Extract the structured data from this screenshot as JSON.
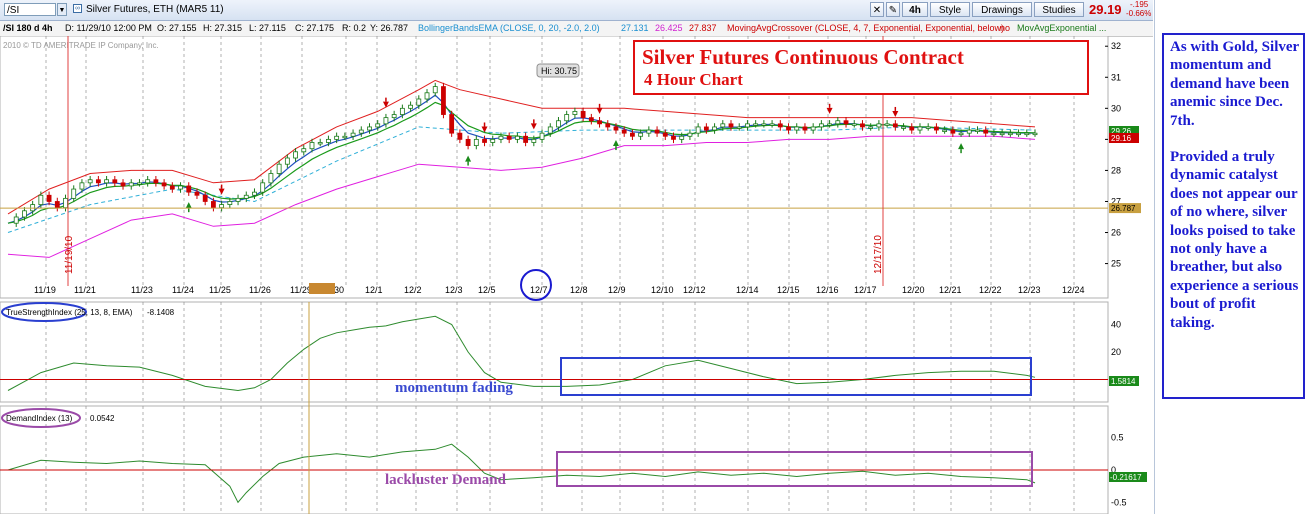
{
  "toolbar": {
    "symbol": "/SI",
    "instrument": "Silver Futures, ETH (MAR5 11)",
    "timeframe": "4h",
    "style_label": "Style",
    "drawings_label": "Drawings",
    "studies_label": "Studies",
    "last_price": "29.19",
    "change_abs": "-.195",
    "change_pct": "-0.66%"
  },
  "infobar": {
    "chart_id": "/SI 180 d 4h",
    "date": "D: 11/29/10 12:00 PM",
    "open": "O: 27.155",
    "high": "H: 27.315",
    "low": "L: 27.115",
    "close": "C: 27.175",
    "range": "R: 0.2",
    "y": "Y: 26.787",
    "bb_study": "BollingerBandsEMA (CLOSE, 0, 20, -2.0, 2.0)",
    "bb_v1": "27.131",
    "bb_v2": "26.425",
    "bb_v3": "27.837",
    "ma_study": "MovingAvgCrossover (CLOSE, 4, 7, Exponential, Exponential, below)",
    "ma_flag": "no",
    "ma_study2": "MovAvgExponential ..."
  },
  "annotations": {
    "title_line1": "Silver Futures Continuous Contract",
    "title_line2": "4 Hour Chart",
    "momentum_note": "momentum fading",
    "demand_note": "lackluster Demand",
    "side_para1": "As with Gold, Silver momentum and demand have been anemic since Dec. 7th.",
    "side_para2": "Provided a truly dynamic catalyst does not appear our of no where, silver looks poised to take not only have a breather, but also experience a serious bout of profit taking."
  },
  "colors": {
    "price_up": "#1a7a1a",
    "price_down": "#cc0000",
    "bb_upper": "#e02020",
    "bb_lower": "#e020e0",
    "bb_mid": "#30b0d8",
    "ma_fast": "#1f4fbf",
    "ma_slow": "#1a9a1a",
    "indicator_line": "#2e8b2e",
    "zero_line": "#cc0000",
    "title_red": "#e01010",
    "blue_box": "#2a3fd0",
    "purple_box": "#9a4aa8"
  },
  "chart_data": [
    {
      "type": "line",
      "title": "Silver Futures Continuous Contract",
      "subtitle": "4 Hour Chart",
      "copyright": "2010 © TD AMERITRADE IP Company, Inc.",
      "x_ticks": [
        "11/19",
        "11/21",
        "11/23",
        "11/24",
        "11/25",
        "11/26",
        "11/29",
        "12:00",
        "30",
        "12/1",
        "12/2",
        "12/3",
        "12/5",
        "12/7",
        "12/8",
        "12/9",
        "12/10",
        "12/12",
        "12/14",
        "12/15",
        "12/16",
        "12/17",
        "12/20",
        "12/21",
        "12/22",
        "12/23",
        "12/24"
      ],
      "y_ticks": [
        25,
        26,
        27,
        28,
        29,
        30,
        31,
        32
      ],
      "ylim": [
        24.6,
        32.2
      ],
      "vertical_labels": [
        "11/19/10",
        "12/17/10"
      ],
      "hi_label": "Hi: 30.75",
      "price_labels": [
        "29.26",
        "29.16",
        "26.787"
      ],
      "horizontal_level": 26.787,
      "series": [
        {
          "name": "price",
          "x": [
            0,
            2,
            4,
            6,
            8,
            10,
            12,
            14,
            16,
            18,
            20,
            22,
            24,
            26,
            28,
            30,
            32,
            34,
            36,
            38,
            40,
            42,
            44,
            46,
            48,
            50,
            52,
            54,
            56,
            58,
            60,
            62,
            64,
            66,
            68,
            70,
            72,
            74,
            76,
            78,
            80,
            82,
            84,
            86,
            88,
            90,
            92,
            94,
            96,
            98,
            100,
            102,
            104,
            106,
            108,
            110,
            112,
            114,
            116,
            118,
            120,
            122,
            124,
            126,
            128,
            130,
            132,
            134,
            136,
            138,
            140,
            142,
            144,
            146,
            148,
            150,
            152,
            154,
            156,
            158,
            160,
            162,
            164,
            166,
            168,
            170,
            172,
            174,
            176,
            178,
            180,
            182,
            184,
            186,
            188,
            190,
            192,
            194,
            196,
            198,
            200,
            202,
            204,
            206,
            208,
            210,
            212,
            214,
            216,
            218,
            220,
            222,
            224,
            226,
            228,
            230,
            232,
            234,
            236,
            238,
            240,
            242,
            244,
            246,
            248,
            250
          ],
          "values": [
            26.3,
            26.5,
            26.7,
            26.9,
            27.2,
            27.0,
            26.8,
            27.1,
            27.4,
            27.6,
            27.7,
            27.6,
            27.7,
            27.6,
            27.5,
            27.6,
            27.6,
            27.7,
            27.6,
            27.5,
            27.4,
            27.5,
            27.3,
            27.2,
            27.0,
            26.8,
            26.9,
            27.0,
            27.1,
            27.2,
            27.3,
            27.6,
            27.9,
            28.2,
            28.4,
            28.6,
            28.7,
            28.9,
            28.9,
            29.0,
            29.1,
            29.1,
            29.2,
            29.3,
            29.4,
            29.5,
            29.7,
            29.8,
            30.0,
            30.1,
            30.3,
            30.5,
            30.7,
            29.8,
            29.2,
            29.0,
            28.8,
            29.0,
            28.9,
            29.0,
            29.1,
            29.0,
            29.1,
            28.9,
            29.0,
            29.2,
            29.4,
            29.6,
            29.8,
            29.9,
            29.7,
            29.6,
            29.5,
            29.4,
            29.3,
            29.2,
            29.1,
            29.2,
            29.3,
            29.2,
            29.1,
            29.0,
            29.1,
            29.2,
            29.4,
            29.3,
            29.4,
            29.5,
            29.4,
            29.4,
            29.5,
            29.5,
            29.5,
            29.5,
            29.4,
            29.3,
            29.4,
            29.3,
            29.4,
            29.5,
            29.5,
            29.6,
            29.5,
            29.5,
            29.4,
            29.4,
            29.5,
            29.5,
            29.4,
            29.4,
            29.3,
            29.4,
            29.4,
            29.3,
            29.3,
            29.2,
            29.2,
            29.3,
            29.3,
            29.2,
            29.2,
            29.2,
            29.2,
            29.2,
            29.2,
            29.2
          ]
        },
        {
          "name": "bb_upper",
          "x": [
            0,
            10,
            20,
            30,
            40,
            50,
            60,
            70,
            80,
            90,
            100,
            104,
            110,
            120,
            130,
            140,
            150,
            160,
            170,
            180,
            190,
            200,
            210,
            220,
            230,
            240,
            250
          ],
          "values": [
            26.6,
            27.4,
            27.9,
            28.0,
            28.0,
            27.6,
            27.7,
            28.7,
            29.4,
            29.9,
            30.6,
            30.9,
            30.6,
            30.3,
            30.0,
            30.0,
            30.0,
            29.9,
            29.8,
            29.7,
            29.7,
            29.7,
            29.7,
            29.7,
            29.6,
            29.5,
            29.4
          ]
        },
        {
          "name": "bb_lower",
          "x": [
            0,
            10,
            20,
            30,
            40,
            50,
            60,
            70,
            80,
            90,
            100,
            110,
            120,
            130,
            140,
            150,
            160,
            170,
            180,
            190,
            200,
            210,
            220,
            230,
            240,
            250
          ],
          "values": [
            25.3,
            25.2,
            25.8,
            26.4,
            26.6,
            26.2,
            26.3,
            26.9,
            27.4,
            27.8,
            28.2,
            28.1,
            28.0,
            28.1,
            28.4,
            28.8,
            28.8,
            28.9,
            28.9,
            29.0,
            29.0,
            29.1,
            29.1,
            29.1,
            29.1,
            29.0
          ]
        },
        {
          "name": "bb_mid",
          "x": [
            0,
            20,
            40,
            60,
            80,
            100,
            120,
            140,
            160,
            180,
            200,
            220,
            250
          ],
          "values": [
            26.0,
            26.9,
            27.4,
            27.0,
            28.3,
            29.4,
            29.2,
            29.3,
            29.3,
            29.3,
            29.3,
            29.4,
            29.3
          ]
        }
      ]
    },
    {
      "type": "line",
      "title": "TrueStrengthIndex (25, 13, 8, EMA)",
      "current_value": -8.1408,
      "value_label": "1.5814",
      "y_ticks": [
        0,
        20,
        40
      ],
      "ylim": [
        -12,
        52
      ],
      "x": [
        0,
        8,
        16,
        24,
        32,
        40,
        48,
        56,
        60,
        64,
        68,
        72,
        76,
        80,
        84,
        88,
        92,
        96,
        100,
        104,
        108,
        112,
        116,
        120,
        128,
        136,
        144,
        152,
        160,
        168,
        176,
        184,
        192,
        200,
        208,
        216,
        224,
        232,
        240,
        248,
        250
      ],
      "values": [
        -8,
        5,
        12,
        10,
        9,
        3,
        -5,
        -8,
        -6,
        0,
        12,
        22,
        30,
        34,
        36,
        38,
        39,
        42,
        44,
        46,
        40,
        20,
        5,
        -2,
        -5,
        -5,
        -4,
        0,
        10,
        14,
        8,
        2,
        -3,
        -2,
        0,
        3,
        5,
        6,
        6,
        3,
        1.58
      ]
    },
    {
      "type": "line",
      "title": "DemandIndex (13)",
      "current_value": 0.0542,
      "value_label": "-0.21617",
      "y_ticks": [
        0.5,
        0,
        -0.5
      ],
      "ylim": [
        -0.65,
        0.65
      ],
      "x": [
        0,
        8,
        16,
        24,
        32,
        40,
        48,
        54,
        56,
        58,
        62,
        66,
        72,
        80,
        88,
        96,
        104,
        108,
        112,
        116,
        120,
        128,
        136,
        144,
        152,
        160,
        168,
        176,
        184,
        192,
        200,
        208,
        216,
        224,
        232,
        240,
        248,
        250
      ],
      "values": [
        0.0,
        0.15,
        0.12,
        0.1,
        0.14,
        0.1,
        0.08,
        -0.25,
        -0.5,
        -0.35,
        -0.1,
        0.1,
        0.2,
        0.25,
        0.2,
        0.28,
        0.32,
        0.4,
        0.2,
        -0.05,
        -0.15,
        -0.12,
        -0.08,
        -0.1,
        -0.05,
        -0.1,
        -0.03,
        -0.08,
        -0.05,
        -0.1,
        -0.05,
        -0.02,
        -0.08,
        -0.05,
        -0.1,
        -0.12,
        -0.15,
        -0.2
      ]
    }
  ]
}
